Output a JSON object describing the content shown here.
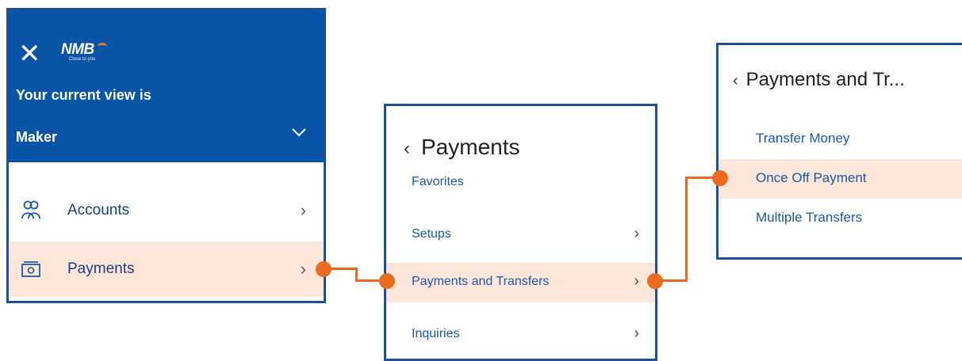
{
  "panel1": {
    "logo_text": "NMB",
    "logo_tagline": "Close to you",
    "view_label": "Your current view is",
    "role": "Maker",
    "items": [
      {
        "label": "Accounts",
        "icon": "accounts-icon"
      },
      {
        "label": "Payments",
        "icon": "payments-icon",
        "active": true
      }
    ]
  },
  "panel2": {
    "back_title": "Payments",
    "items": [
      {
        "label": "Favorites"
      },
      {
        "label": "Setups"
      },
      {
        "label": "Payments and Transfers",
        "active": true
      },
      {
        "label": "Inquiries"
      }
    ]
  },
  "panel3": {
    "back_title": "Payments and Tr...",
    "items": [
      {
        "label": "Transfer Money"
      },
      {
        "label": "Once Off Payment",
        "active": true
      },
      {
        "label": "Multiple Transfers"
      }
    ]
  },
  "colors": {
    "header_blue": "#0a54a8",
    "border_blue": "#1e4f9c",
    "highlight": "#fbe6d9",
    "connector_orange": "#ec6a1d",
    "link_blue": "#1c58a8"
  }
}
